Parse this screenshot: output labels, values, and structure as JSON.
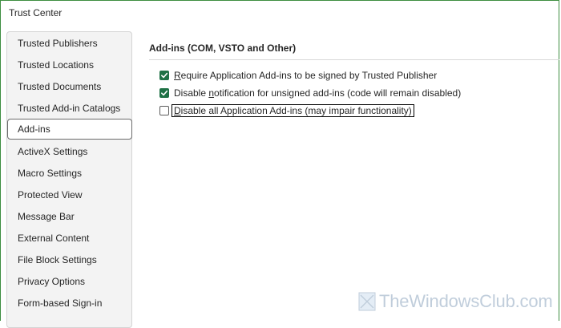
{
  "window": {
    "title": "Trust Center"
  },
  "sidebar": {
    "items": [
      {
        "label": "Trusted Publishers"
      },
      {
        "label": "Trusted Locations"
      },
      {
        "label": "Trusted Documents"
      },
      {
        "label": "Trusted Add-in Catalogs"
      },
      {
        "label": "Add-ins",
        "selected": true
      },
      {
        "label": "ActiveX Settings"
      },
      {
        "label": "Macro Settings"
      },
      {
        "label": "Protected View"
      },
      {
        "label": "Message Bar"
      },
      {
        "label": "External Content"
      },
      {
        "label": "File Block Settings"
      },
      {
        "label": "Privacy Options"
      },
      {
        "label": "Form-based Sign-in"
      }
    ]
  },
  "section": {
    "title": "Add-ins (COM, VSTO and Other)"
  },
  "options": [
    {
      "pre": "",
      "access_key": "R",
      "post": "equire Application Add-ins to be signed by Trusted Publisher",
      "checked": true
    },
    {
      "pre": "Disable ",
      "access_key": "n",
      "post": "otification for unsigned add-ins (code will remain disabled)",
      "checked": true
    },
    {
      "pre": "",
      "access_key": "D",
      "post": "isable all Application Add-ins (may impair functionality)",
      "checked": false,
      "focused": true
    }
  ],
  "watermark": {
    "text": "TheWindowsClub.com",
    "icon": "windows-logo-icon"
  },
  "colors": {
    "accent": "#1e7145",
    "window_border": "#3e8e41",
    "sidebar_bg": "#f3f3f3",
    "watermark": "#8da6bf"
  }
}
